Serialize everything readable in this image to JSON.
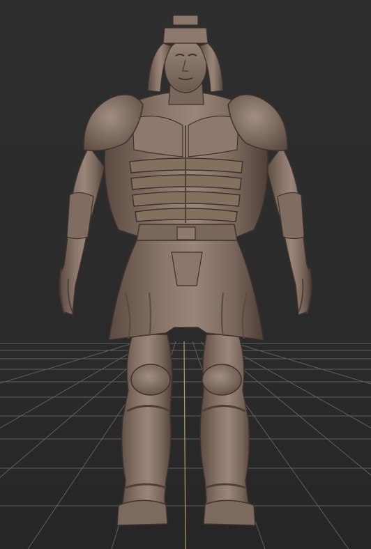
{
  "viewport": {
    "background_color": "#2b2b2b",
    "grid_line_color": "#6a6a6a",
    "grid_axis_color": "#b8a25a"
  },
  "model": {
    "subject": "armored-warrior-sculpt",
    "material_color": "#8a766a",
    "material_shadow_color": "#4e3f37",
    "material_highlight_color": "#b3a093"
  }
}
